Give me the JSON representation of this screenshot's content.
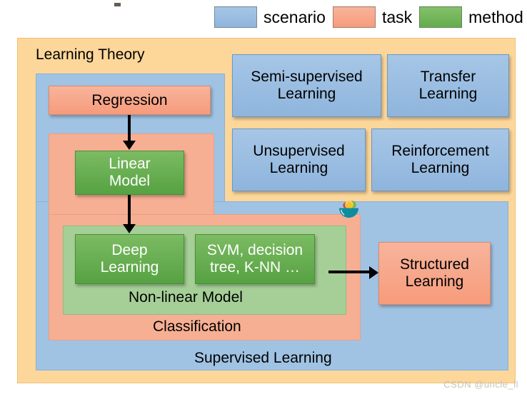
{
  "legend": {
    "items": [
      {
        "label": "scenario",
        "color": "#8fb5dd",
        "icon": "legend-swatch-blue"
      },
      {
        "label": "task",
        "color": "#f79b7c",
        "icon": "legend-swatch-red"
      },
      {
        "label": "method",
        "color": "#6bb054",
        "icon": "legend-swatch-green"
      }
    ]
  },
  "diagram": {
    "title": "Learning Theory",
    "supervised_label": "Supervised Learning",
    "classification_label": "Classification",
    "nonlinear_label": "Non-linear Model",
    "nodes": {
      "regression": "Regression",
      "linear_model": "Linear\nModel",
      "deep_learning": "Deep\nLearning",
      "svm": "SVM, decision\ntree, K-NN …",
      "structured_learning": "Structured\nLearning"
    },
    "scenarios": {
      "semi_supervised": "Semi-supervised\nLearning",
      "transfer": "Transfer\nLearning",
      "unsupervised": "Unsupervised\nLearning",
      "reinforcement": "Reinforcement\nLearning"
    },
    "icon": "bowl-of-food-emoji"
  },
  "watermark": "CSDN @uncle_ll"
}
